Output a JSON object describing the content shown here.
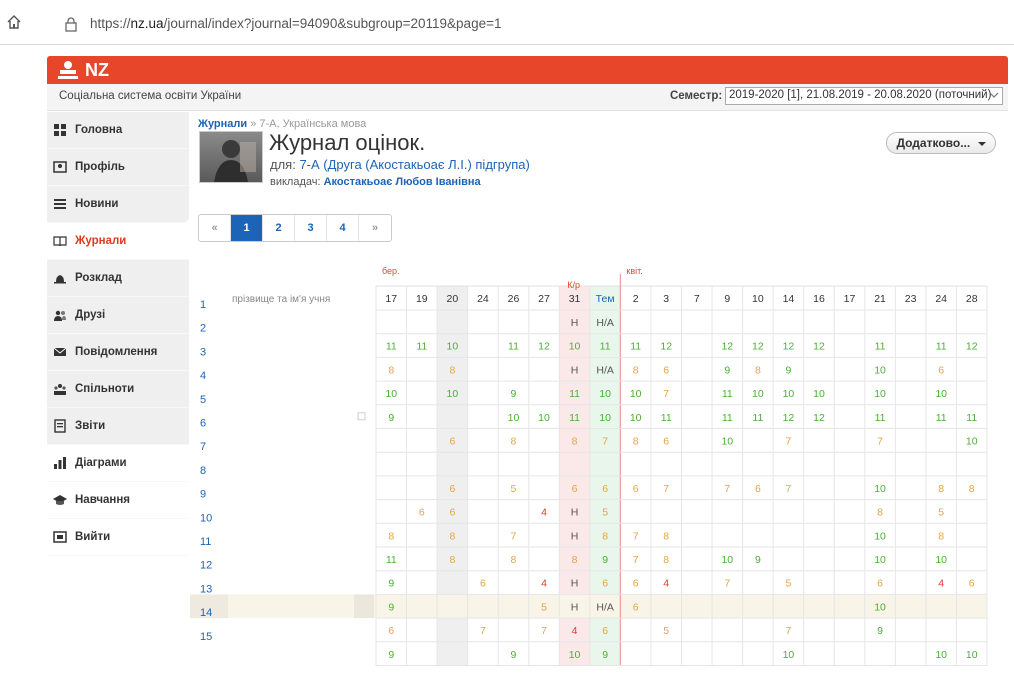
{
  "browser": {
    "url_prefix": "https://",
    "url_host": "nz.ua",
    "url_rest": "/journal/index?journal=94090&subgroup=20119&page=1"
  },
  "brand": {
    "name": "NZ",
    "tagline": "Соціальна система освіти України",
    "color": "#e8462a"
  },
  "semester": {
    "label": "Семестр:",
    "value": "2019-2020 [1], 21.08.2019 - 20.08.2020 (поточний)"
  },
  "sidebar": {
    "items": [
      {
        "label": "Головна",
        "icon": "grid-icon"
      },
      {
        "label": "Профіль",
        "icon": "profile-card-icon"
      },
      {
        "label": "Новини",
        "icon": "news-lines-icon"
      },
      {
        "label": "Журнали",
        "icon": "book-icon",
        "active": true
      },
      {
        "label": "Розклад",
        "icon": "bell-icon"
      },
      {
        "label": "Друзі",
        "icon": "people-icon"
      },
      {
        "label": "Повідомлення",
        "icon": "envelope-icon"
      },
      {
        "label": "Спільноти",
        "icon": "community-icon"
      },
      {
        "label": "Звіти",
        "icon": "report-icon"
      },
      {
        "label": "Діаграми",
        "icon": "bar-chart-icon"
      },
      {
        "label": "Навчання",
        "icon": "graduation-cap-icon"
      },
      {
        "label": "Вийти",
        "icon": "exit-icon"
      }
    ]
  },
  "header": {
    "crumb_link": "Журнали",
    "crumb_sep": "»",
    "crumb_current": "7-А, Українська мова",
    "title": "Журнал оцінок.",
    "for_label": "для:",
    "for_value": "7-А (Друга (Акостакьоає Л.І.) підгрупа)",
    "teacher_label": "викладач:",
    "teacher_value": "Акостакьоає Любов Іванівна",
    "more_button": "Додатково..."
  },
  "pagination": {
    "prev": "«",
    "pages": [
      "1",
      "2",
      "3",
      "4"
    ],
    "current": "1",
    "next": "»"
  },
  "journal": {
    "student_header": "прізвище та ім'я учня",
    "month_labels": [
      {
        "label": "бер.",
        "col": 0
      },
      {
        "label": "квіт.",
        "col": 8
      }
    ],
    "special_label": {
      "label": "К/р",
      "col": 6
    },
    "columns": [
      "17",
      "19",
      "20",
      "24",
      "26",
      "27",
      "31",
      "Тем",
      "2",
      "3",
      "7",
      "9",
      "10",
      "14",
      "16",
      "17",
      "21",
      "23",
      "24",
      "28"
    ],
    "rows": [
      {
        "n": "1",
        "marks": [
          "",
          "",
          "",
          "",
          "",
          "",
          "Н",
          "Н/А",
          "",
          "",
          "",
          "",
          "",
          "",
          "",
          "",
          "",
          "",
          "",
          ""
        ]
      },
      {
        "n": "2",
        "marks": [
          "11",
          "11",
          "10",
          "",
          "11",
          "12",
          "10",
          "11",
          "11",
          "12",
          "",
          "12",
          "12",
          "12",
          "12",
          "",
          "11",
          "",
          "11",
          "12"
        ]
      },
      {
        "n": "3",
        "marks": [
          "8",
          "",
          "8",
          "",
          "",
          "",
          "Н",
          "Н/А",
          "8",
          "6",
          "",
          "9",
          "8",
          "9",
          "",
          "",
          "10",
          "",
          "6",
          ""
        ]
      },
      {
        "n": "4",
        "marks": [
          "10",
          "",
          "10",
          "",
          "9",
          "",
          "11",
          "10",
          "10",
          "7",
          "",
          "11",
          "10",
          "10",
          "10",
          "",
          "10",
          "",
          "10",
          ""
        ]
      },
      {
        "n": "5",
        "marks": [
          "9",
          "",
          "",
          "",
          "10",
          "10",
          "11",
          "10",
          "10",
          "11",
          "",
          "11",
          "11",
          "12",
          "12",
          "",
          "11",
          "",
          "11",
          "11"
        ]
      },
      {
        "n": "6",
        "marks": [
          "",
          "",
          "6",
          "",
          "8",
          "",
          "8",
          "7",
          "8",
          "6",
          "",
          "10",
          "",
          "7",
          "",
          "",
          "7",
          "",
          "",
          "10"
        ]
      },
      {
        "n": "7",
        "marks": [
          "",
          "",
          "",
          "",
          "",
          "",
          "",
          "",
          "",
          "",
          "",
          "",
          "",
          "",
          "",
          "",
          "",
          "",
          "",
          ""
        ]
      },
      {
        "n": "8",
        "marks": [
          "",
          "",
          "6",
          "",
          "5",
          "",
          "6",
          "6",
          "6",
          "7",
          "",
          "7",
          "6",
          "7",
          "",
          "",
          "10",
          "",
          "8",
          "8"
        ]
      },
      {
        "n": "9",
        "marks": [
          "",
          "6",
          "6",
          "",
          "",
          "4",
          "Н",
          "5",
          "",
          "",
          "",
          "",
          "",
          "",
          "",
          "",
          "8",
          "",
          "5",
          ""
        ]
      },
      {
        "n": "10",
        "marks": [
          "8",
          "",
          "8",
          "",
          "7",
          "",
          "Н",
          "8",
          "7",
          "8",
          "",
          "",
          "",
          "",
          "",
          "",
          "10",
          "",
          "8",
          ""
        ]
      },
      {
        "n": "11",
        "marks": [
          "11",
          "",
          "8",
          "",
          "8",
          "",
          "8",
          "9",
          "7",
          "8",
          "",
          "10",
          "9",
          "",
          "",
          "",
          "10",
          "",
          "10",
          ""
        ]
      },
      {
        "n": "12",
        "marks": [
          "9",
          "",
          "",
          "6",
          "",
          "4",
          "Н",
          "6",
          "6",
          "4",
          "",
          "7",
          "",
          "5",
          "",
          "",
          "6",
          "",
          "4",
          "6"
        ]
      },
      {
        "n": "13",
        "marks": [
          "9",
          "",
          "",
          "",
          "",
          "5",
          "Н",
          "Н/А",
          "6",
          "",
          "",
          "",
          "",
          "",
          "",
          "",
          "10",
          "",
          "",
          ""
        ],
        "highlight": true
      },
      {
        "n": "14",
        "marks": [
          "6",
          "",
          "",
          "7",
          "",
          "7",
          "4",
          "6",
          "",
          "5",
          "",
          "",
          "",
          "7",
          "",
          "",
          "9",
          "",
          "",
          ""
        ]
      },
      {
        "n": "15",
        "marks": [
          "9",
          "",
          "",
          "",
          "9",
          "",
          "10",
          "9",
          "",
          "",
          "",
          "",
          "",
          "10",
          "",
          "",
          "",
          "",
          "10",
          "10"
        ]
      }
    ]
  }
}
